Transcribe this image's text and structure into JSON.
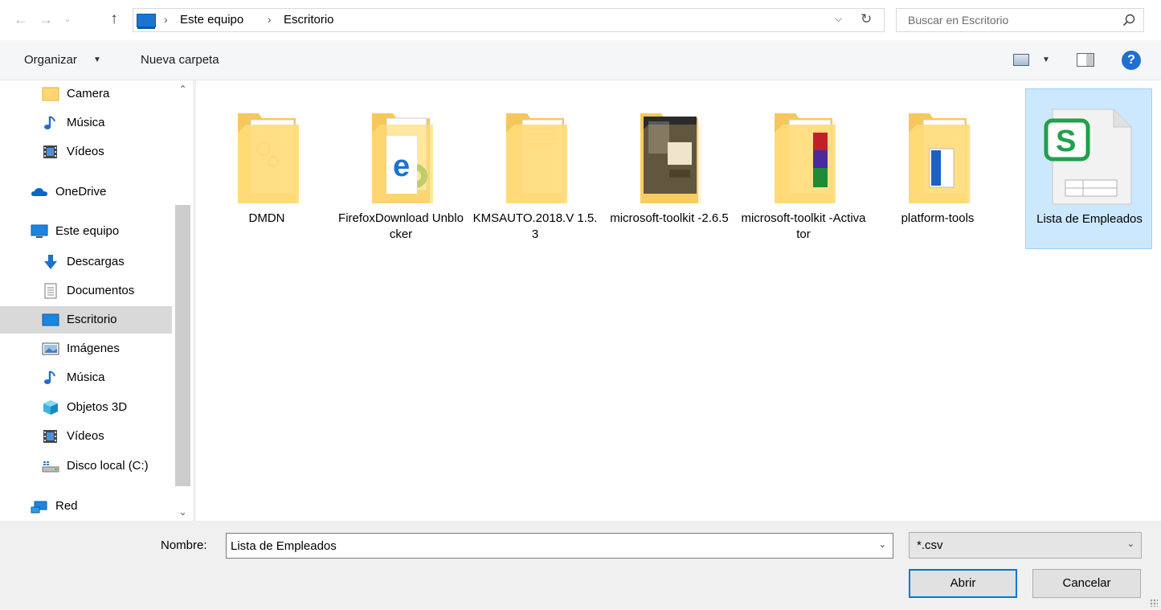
{
  "address_bar": {
    "breadcrumbs": [
      "Este equipo",
      "Escritorio"
    ],
    "search_placeholder": "Buscar en Escritorio"
  },
  "toolbar": {
    "organize_label": "Organizar",
    "new_folder_label": "Nueva carpeta"
  },
  "navigation_pane": {
    "items": [
      {
        "label": "Camera",
        "icon": "folder-icon"
      },
      {
        "label": "Música",
        "icon": "music-icon"
      },
      {
        "label": "Vídeos",
        "icon": "videos-icon"
      },
      {
        "label": "OneDrive",
        "icon": "onedrive-icon"
      },
      {
        "label": "Este equipo",
        "icon": "computer-icon"
      },
      {
        "label": "Descargas",
        "icon": "download-icon"
      },
      {
        "label": "Documentos",
        "icon": "documents-icon"
      },
      {
        "label": "Escritorio",
        "icon": "desktop-icon",
        "selected": true
      },
      {
        "label": "Imágenes",
        "icon": "pictures-icon"
      },
      {
        "label": "Música",
        "icon": "music-icon"
      },
      {
        "label": "Objetos 3D",
        "icon": "objects-3d-icon"
      },
      {
        "label": "Vídeos",
        "icon": "videos-icon"
      },
      {
        "label": "Disco local (C:)",
        "icon": "drive-icon"
      },
      {
        "label": "Red",
        "icon": "network-icon"
      }
    ]
  },
  "files": [
    {
      "name": "DMDN",
      "type": "folder",
      "preview": "gears"
    },
    {
      "name": "FirefoxDownload Unblocker",
      "type": "folder",
      "preview": "browser"
    },
    {
      "name": "KMSAUTO.2018.V 1.5.3",
      "type": "folder",
      "preview": "document"
    },
    {
      "name": "microsoft-toolkit -2.6.5",
      "type": "folder",
      "preview": "dark"
    },
    {
      "name": "microsoft-toolkit -Activator",
      "type": "folder",
      "preview": "winrar"
    },
    {
      "name": "platform-tools",
      "type": "folder",
      "preview": "blue-doc"
    },
    {
      "name": "Lista de Empleados",
      "type": "spreadsheet",
      "selected": true
    }
  ],
  "bottom": {
    "name_label": "Nombre:",
    "name_value": "Lista de Empleados",
    "file_type": "*.csv",
    "open_button": "Abrir",
    "cancel_button": "Cancelar"
  },
  "colors": {
    "selection_bg": "#cce8ff",
    "selection_border": "#99d1ff",
    "accent": "#0078d7",
    "folder": "#ffd76e",
    "spreadsheet_green": "#22a04b"
  }
}
